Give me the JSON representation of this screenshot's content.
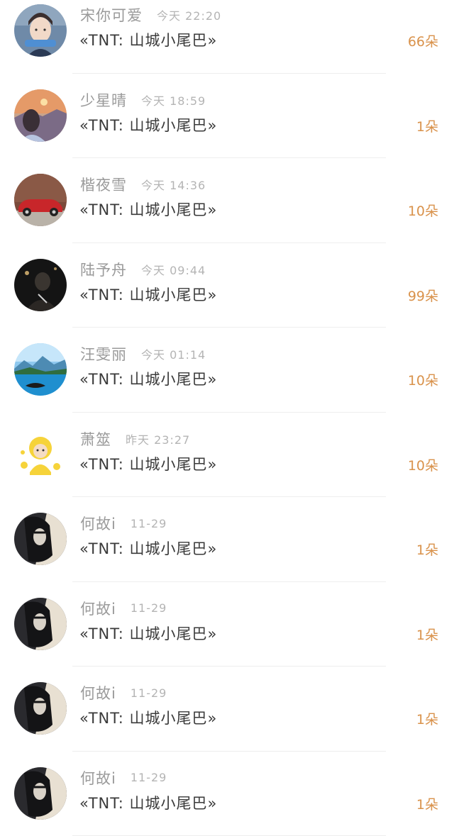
{
  "records": [
    {
      "name": "宋你可爱",
      "time": "今天 22:20",
      "gift": "«TNT: 山城小尾巴»",
      "count": "66朵",
      "avatar": "avatar-boy-headphones"
    },
    {
      "name": "少星晴",
      "time": "今天 18:59",
      "gift": "«TNT: 山城小尾巴»",
      "count": "1朵",
      "avatar": "avatar-sunset-girl"
    },
    {
      "name": "楷夜雪",
      "time": "今天 14:36",
      "gift": "«TNT: 山城小尾巴»",
      "count": "10朵",
      "avatar": "avatar-red-car"
    },
    {
      "name": "陆予舟",
      "time": "今天 09:44",
      "gift": "«TNT: 山城小尾巴»",
      "count": "99朵",
      "avatar": "avatar-dark-portrait"
    },
    {
      "name": "汪雯丽",
      "time": "今天 01:14",
      "gift": "«TNT: 山城小尾巴»",
      "count": "10朵",
      "avatar": "avatar-lake-landscape"
    },
    {
      "name": "萧筮",
      "time": "昨天 23:27",
      "gift": "«TNT: 山城小尾巴»",
      "count": "10朵",
      "avatar": "avatar-yellow-chick"
    },
    {
      "name": "何故i",
      "time": "11-29",
      "gift": "«TNT: 山城小尾巴»",
      "count": "1朵",
      "avatar": "avatar-anime-girl"
    },
    {
      "name": "何故i",
      "time": "11-29",
      "gift": "«TNT: 山城小尾巴»",
      "count": "1朵",
      "avatar": "avatar-anime-girl"
    },
    {
      "name": "何故i",
      "time": "11-29",
      "gift": "«TNT: 山城小尾巴»",
      "count": "1朵",
      "avatar": "avatar-anime-girl"
    },
    {
      "name": "何故i",
      "time": "11-29",
      "gift": "«TNT: 山城小尾巴»",
      "count": "1朵",
      "avatar": "avatar-anime-girl"
    }
  ]
}
